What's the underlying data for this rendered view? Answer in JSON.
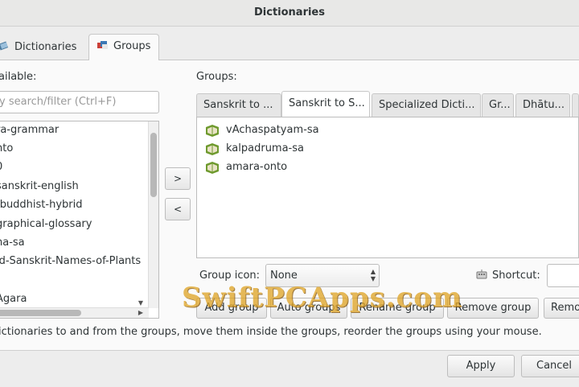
{
  "window": {
    "title": "Dictionaries"
  },
  "top_tabs": [
    {
      "label": "Dictionaries",
      "active": false
    },
    {
      "label": "Groups",
      "active": true
    }
  ],
  "available": {
    "label": "ailable:",
    "filter_placeholder": "y search/filter (Ctrl+F)",
    "items": [
      "ra-grammar",
      "nto",
      "0",
      "sanskrit-english",
      "-buddhist-hybrid",
      "graphical-glossary",
      "na-sa",
      "ld-Sanskrit-Names-of-Plants",
      "",
      "Agara"
    ]
  },
  "move_buttons": {
    "add": ">",
    "remove": "<"
  },
  "groups": {
    "label": "Groups:",
    "tabs": [
      {
        "label": "Sanskrit to ...",
        "selected": false
      },
      {
        "label": "Sanskrit to S...",
        "selected": true
      },
      {
        "label": "Specialized Dicti...",
        "selected": false
      },
      {
        "label": "Gr...",
        "selected": false
      },
      {
        "label": "Dhātu...",
        "selected": false
      }
    ],
    "items": [
      "vAchaspatyam-sa",
      "kalpadruma-sa",
      "amara-onto"
    ],
    "group_icon_label": "Group icon:",
    "group_icon_value": "None",
    "shortcut_label": "Shortcut:"
  },
  "action_buttons": [
    "Add group",
    "Auto groups",
    "Rename group",
    "Remove group",
    "Remo"
  ],
  "hint": "ictionaries to and from the groups, move them inside the groups, reorder the groups using your mouse.",
  "footer": {
    "apply": "Apply",
    "cancel": "Cancel"
  },
  "watermark": "SwiftPCApps.com",
  "colors": {
    "book_green": "#6f9a2e",
    "book_page": "#e9e3c6",
    "watermark": "#e0a62a"
  }
}
